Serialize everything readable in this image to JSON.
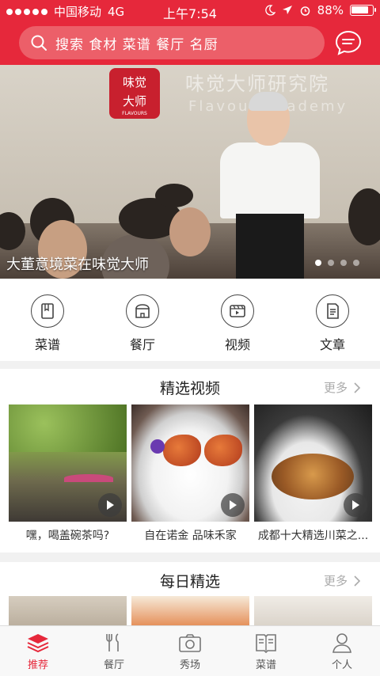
{
  "status": {
    "carrier": "中国移动",
    "network": "4G",
    "time": "上午7:54",
    "battery": "88%",
    "battery_level": 0.88
  },
  "header": {
    "search_placeholder": "搜索 食材 菜谱 餐厅 名厨",
    "search_icon": "search-icon",
    "message_icon": "chat-bubble-icon"
  },
  "banner": {
    "logo_text": [
      "味觉",
      "大师"
    ],
    "logo_sub": "FLAVOURS",
    "wall_title": "味觉大师研究院",
    "wall_sub": "Flavour Academy",
    "caption": "大董意境菜在味觉大师",
    "page_count": 4,
    "active_page": 1
  },
  "categories": [
    {
      "label": "菜谱",
      "icon": "recipe-book-icon"
    },
    {
      "label": "餐厅",
      "icon": "restaurant-storefront-icon"
    },
    {
      "label": "视频",
      "icon": "video-icon"
    },
    {
      "label": "文章",
      "icon": "article-icon"
    }
  ],
  "featured_videos": {
    "title": "精选视频",
    "more": "更多",
    "items": [
      {
        "label": "嘿，喝盖碗茶吗?"
      },
      {
        "label": "自在诺金 品味禾家"
      },
      {
        "label": "成都十大精选川菜之..."
      }
    ]
  },
  "daily_picks": {
    "title": "每日精选",
    "more": "更多"
  },
  "tabbar": [
    {
      "label": "推荐",
      "icon": "layers-icon",
      "active": true
    },
    {
      "label": "餐厅",
      "icon": "fork-knife-icon",
      "active": false
    },
    {
      "label": "秀场",
      "icon": "camera-icon",
      "active": false
    },
    {
      "label": "菜谱",
      "icon": "recipe-book-icon",
      "active": false
    },
    {
      "label": "个人",
      "icon": "person-icon",
      "active": false
    }
  ],
  "colors": {
    "brand": "#e6283b",
    "active_tab": "#e6283b"
  }
}
